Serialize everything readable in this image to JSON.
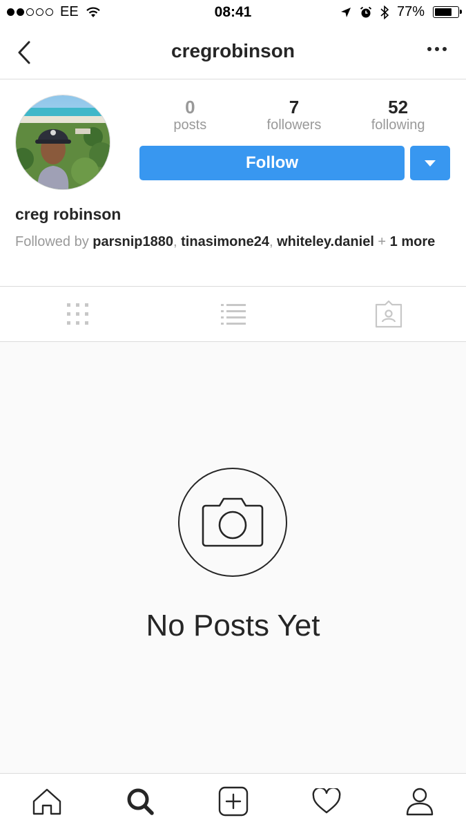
{
  "status_bar": {
    "carrier": "EE",
    "time": "08:41",
    "battery_percent": "77%",
    "battery_level": 0.77,
    "signal_bars_filled": 2,
    "signal_bars_total": 5
  },
  "header": {
    "title": "cregrobinson",
    "back_icon": "chevron-left-icon",
    "more_icon": "more-horizontal-icon"
  },
  "profile": {
    "stats": [
      {
        "value": "0",
        "label": "posts"
      },
      {
        "value": "7",
        "label": "followers"
      },
      {
        "value": "52",
        "label": "following"
      }
    ],
    "follow_label": "Follow",
    "full_name": "creg robinson",
    "followed_by": {
      "prefix": "Followed by ",
      "users": [
        "parsnip1880",
        "tinasimone24",
        "whiteley.daniel"
      ],
      "separator": ", ",
      "plus": " + ",
      "more": "1 more"
    }
  },
  "tabs": [
    "grid-icon",
    "list-icon",
    "tagged-icon"
  ],
  "empty_state": {
    "title": "No Posts Yet",
    "icon": "camera-icon"
  },
  "bottom_nav": [
    "home-icon",
    "search-icon",
    "add-icon",
    "heart-icon",
    "profile-icon"
  ],
  "colors": {
    "accent": "#3897f0",
    "text": "#262626",
    "muted": "#999999",
    "divider": "#dbdbdb",
    "empty_bg": "#fafafa"
  }
}
